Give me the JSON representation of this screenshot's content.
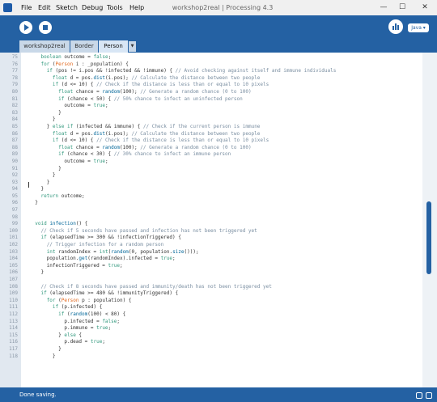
{
  "window": {
    "title": "workshop2real | Processing 4.3",
    "controls": {
      "minimize": "—",
      "maximize": "☐",
      "close": "✕"
    }
  },
  "menu": {
    "items": [
      "File",
      "Edit",
      "Sketch",
      "Debug",
      "Tools",
      "Help"
    ]
  },
  "toolbar": {
    "run": "play-icon",
    "stop": "stop-icon",
    "debug": "bar-chart-icon",
    "mode_label": "Java ▾"
  },
  "tabs": {
    "items": [
      "workshop2real",
      "Border",
      "Person"
    ],
    "active": "Person",
    "menu_arrow": "▼"
  },
  "editor": {
    "lines": [
      {
        "n": "75",
        "text": "    boolean outcome = false;"
      },
      {
        "n": "76",
        "text": "    for (Person i : _population) {"
      },
      {
        "n": "77",
        "text": "      if (pos != i.pos && !infected && !immune) { // Avoid checking against itself and immune individuals"
      },
      {
        "n": "78",
        "text": "        float d = pos.dist(i.pos); // Calculate the distance between two people"
      },
      {
        "n": "79",
        "text": "        if (d <= 10) { // Check if the distance is less than or equal to 10 pixels"
      },
      {
        "n": "80",
        "text": "          float chance = random(100); // Generate a random chance (0 to 100)"
      },
      {
        "n": "81",
        "text": "          if (chance < 50) { // 50% chance to infect an uninfected person"
      },
      {
        "n": "82",
        "text": "            outcome = true;"
      },
      {
        "n": "83",
        "text": "          }"
      },
      {
        "n": "84",
        "text": "        }"
      },
      {
        "n": "85",
        "text": "      } else if (infected && immune) { // Check if the current person is immune"
      },
      {
        "n": "86",
        "text": "        float d = pos.dist(i.pos); // Calculate the distance between two people"
      },
      {
        "n": "87",
        "text": "        if (d <= 10) { // Check if the distance is less than or equal to 10 pixels"
      },
      {
        "n": "88",
        "text": "          float chance = random(100); // Generate a random chance (0 to 100)"
      },
      {
        "n": "89",
        "text": "          if (chance < 30) { // 30% chance to infect an immune person"
      },
      {
        "n": "90",
        "text": "            outcome = true;"
      },
      {
        "n": "91",
        "text": "          }"
      },
      {
        "n": "92",
        "text": "        }"
      },
      {
        "n": "93",
        "text": "      }"
      },
      {
        "n": "94",
        "text": "    }"
      },
      {
        "n": "95",
        "text": "    return outcome;"
      },
      {
        "n": "96",
        "text": "  }"
      },
      {
        "n": "97",
        "text": ""
      },
      {
        "n": "98",
        "text": ""
      },
      {
        "n": "99",
        "text": "  void infection() {"
      },
      {
        "n": "100",
        "text": "    // Check if 5 seconds have passed and infection has not been triggered yet"
      },
      {
        "n": "101",
        "text": "    if (elapsedTime >= 300 && !infectionTriggered) {"
      },
      {
        "n": "102",
        "text": "      // Trigger infection for a random person"
      },
      {
        "n": "103",
        "text": "      int randomIndex = int(random(0, population.size()));"
      },
      {
        "n": "104",
        "text": "      population.get(randomIndex).infected = true;"
      },
      {
        "n": "105",
        "text": "      infectionTriggered = true;"
      },
      {
        "n": "106",
        "text": "    }"
      },
      {
        "n": "107",
        "text": ""
      },
      {
        "n": "108",
        "text": "    // Check if 8 seconds have passed and immunity/death has not been triggered yet"
      },
      {
        "n": "109",
        "text": "    if (elapsedTime >= 480 && !immunityTriggered) {"
      },
      {
        "n": "110",
        "text": "      for (Person p : population) {"
      },
      {
        "n": "111",
        "text": "        if (p.infected) {"
      },
      {
        "n": "112",
        "text": "          if (random(100) < 80) {"
      },
      {
        "n": "113",
        "text": "            p.infected = false;"
      },
      {
        "n": "114",
        "text": "            p.immune = true;"
      },
      {
        "n": "115",
        "text": "          } else {"
      },
      {
        "n": "116",
        "text": "            p.dead = true;"
      },
      {
        "n": "117",
        "text": "          }"
      },
      {
        "n": "118",
        "text": "        }"
      }
    ]
  },
  "status": {
    "text": "Done saving."
  },
  "colors": {
    "toolbar": "#2461a3",
    "keyword": "#33997e",
    "type": "#e2661a",
    "function": "#006699",
    "comment": "#7a8ea1",
    "highlight_line": "#e4f1fb"
  }
}
